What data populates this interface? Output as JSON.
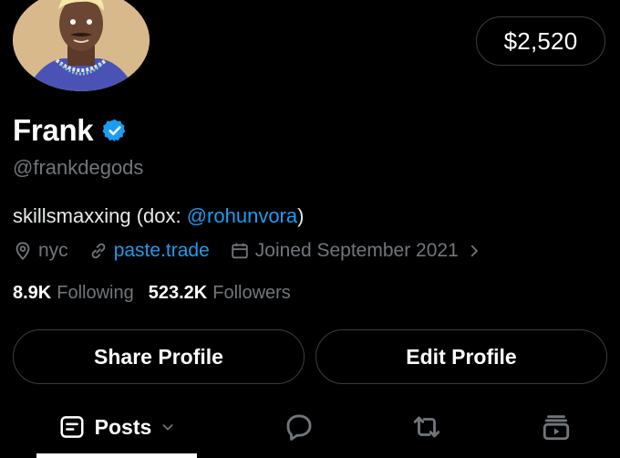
{
  "profile": {
    "avatar_icon": "cartoon-avatar",
    "name": "Frank",
    "verified_icon": "verified-badge-icon",
    "handle": "@frankdegods",
    "bio_text": "skillsmaxxing (dox: ",
    "bio_mention": "@rohunvora",
    "bio_close": ")",
    "location": "nyc",
    "website": "paste.trade",
    "joined": "Joined September 2021",
    "following_count": "8.9K",
    "following_label": "Following",
    "followers_count": "523.2K",
    "followers_label": "Followers"
  },
  "balance": "$2,520",
  "actions": {
    "share_label": "Share Profile",
    "edit_label": "Edit Profile"
  },
  "tabs": {
    "posts_label": "Posts",
    "icons": [
      "posts-icon",
      "chevron-down-icon",
      "reply-icon",
      "repost-icon",
      "media-icon"
    ]
  },
  "colors": {
    "background": "#000000",
    "text": "#e7e9ea",
    "muted": "#71767b",
    "accent": "#1d9bf0",
    "border": "#3a3d41"
  }
}
